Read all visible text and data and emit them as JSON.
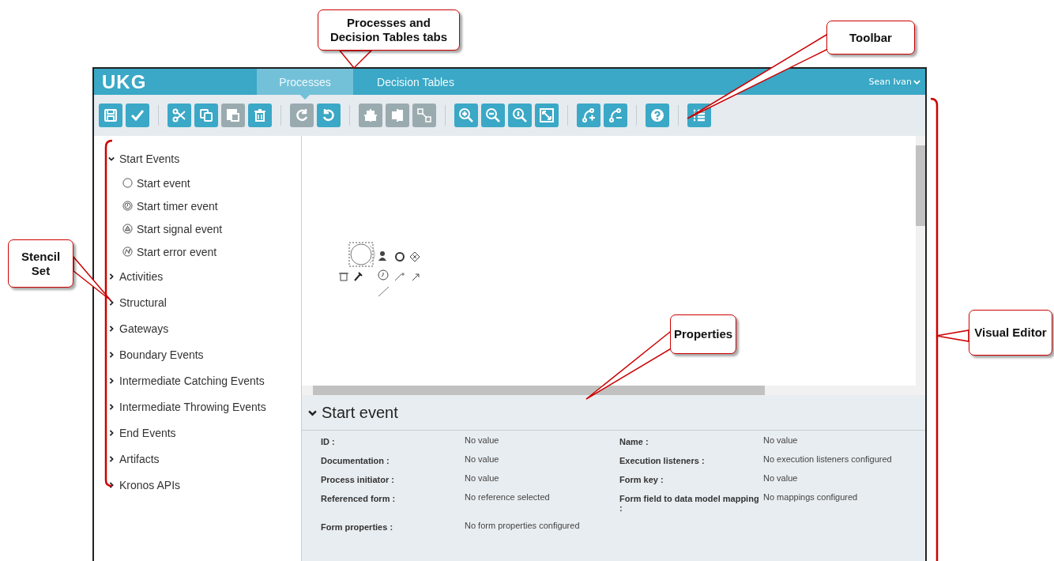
{
  "callouts": [
    {
      "text": "Processes and Decision Tables tabs"
    },
    {
      "text": "Toolbar"
    },
    {
      "text": "Stencil Set"
    },
    {
      "text": "Properties"
    },
    {
      "text": "Visual Editor"
    }
  ],
  "header": {
    "logo": "UKG",
    "tabs": [
      {
        "label": "Processes",
        "selected": true
      },
      {
        "label": "Decision Tables",
        "selected": false
      }
    ],
    "user": "Sean Ivan"
  },
  "toolbar": [
    [
      {
        "kind": "save",
        "disabled": false
      },
      {
        "kind": "validate",
        "disabled": false
      }
    ],
    [
      {
        "kind": "cut",
        "disabled": false
      },
      {
        "kind": "copy",
        "disabled": false
      },
      {
        "kind": "paste",
        "disabled": true
      },
      {
        "kind": "delete",
        "disabled": false
      }
    ],
    [
      {
        "kind": "redo",
        "disabled": true
      },
      {
        "kind": "undo",
        "disabled": false
      }
    ],
    [
      {
        "kind": "align-horizontal",
        "disabled": true
      },
      {
        "kind": "align-vertical",
        "disabled": true
      },
      {
        "kind": "same-size",
        "disabled": true
      }
    ],
    [
      {
        "kind": "zoom-in",
        "disabled": false
      },
      {
        "kind": "zoom-out",
        "disabled": false
      },
      {
        "kind": "zoom-actual",
        "disabled": false
      },
      {
        "kind": "zoom-fit",
        "disabled": false
      }
    ],
    [
      {
        "kind": "add-bendpoint",
        "disabled": false
      },
      {
        "kind": "remove-bendpoint",
        "disabled": false
      }
    ],
    [
      {
        "kind": "help",
        "disabled": false
      }
    ],
    [
      {
        "kind": "list",
        "disabled": false
      }
    ]
  ],
  "stencil": [
    {
      "label": "Start Events",
      "expanded": true,
      "children": [
        {
          "label": "Start event",
          "kind": "plain"
        },
        {
          "label": "Start timer event",
          "kind": "timer"
        },
        {
          "label": "Start signal event",
          "kind": "signal"
        },
        {
          "label": "Start error event",
          "kind": "error"
        }
      ]
    },
    {
      "label": "Activities",
      "expanded": false
    },
    {
      "label": "Structural",
      "expanded": false
    },
    {
      "label": "Gateways",
      "expanded": false
    },
    {
      "label": "Boundary Events",
      "expanded": false
    },
    {
      "label": "Intermediate Catching Events",
      "expanded": false
    },
    {
      "label": "Intermediate Throwing Events",
      "expanded": false
    },
    {
      "label": "End Events",
      "expanded": false
    },
    {
      "label": "Artifacts",
      "expanded": false
    },
    {
      "label": "Kronos APIs",
      "expanded": false
    }
  ],
  "properties": {
    "title": "Start event",
    "expanded": true,
    "fields": [
      {
        "label": "ID :",
        "value": "No value"
      },
      {
        "label": "Name :",
        "value": "No value"
      },
      {
        "label": "Documentation :",
        "value": "No value"
      },
      {
        "label": "Execution listeners :",
        "value": "No execution listeners configured"
      },
      {
        "label": "Process initiator :",
        "value": "No value"
      },
      {
        "label": "Form key :",
        "value": "No value"
      },
      {
        "label": "Referenced form :",
        "value": "No reference selected"
      },
      {
        "label": "Form field to data model mapping :",
        "value": "No mappings configured"
      },
      {
        "label": "Form properties :",
        "value": "No form properties configured"
      }
    ]
  }
}
